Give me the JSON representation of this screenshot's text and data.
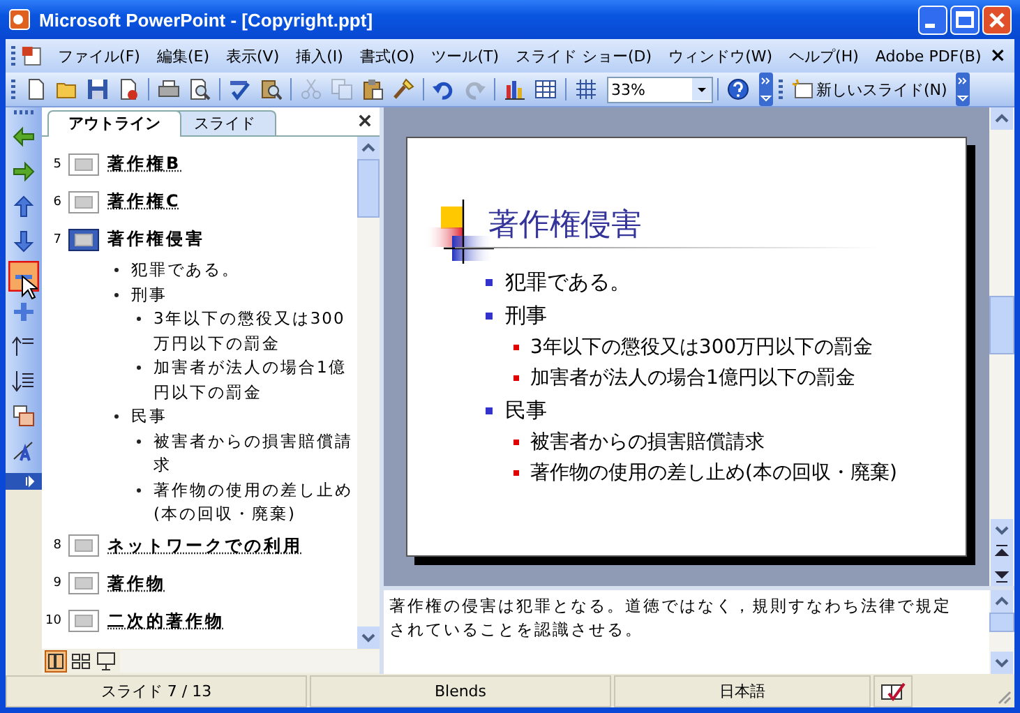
{
  "window": {
    "title": "Microsoft PowerPoint - [Copyright.ppt]"
  },
  "menu": {
    "items": [
      "ファイル(F)",
      "編集(E)",
      "表示(V)",
      "挿入(I)",
      "書式(O)",
      "ツール(T)",
      "スライド ショー(D)",
      "ウィンドウ(W)",
      "ヘルプ(H)",
      "Adobe PDF(B)"
    ],
    "close_glyph": "×"
  },
  "toolbar": {
    "groups": [
      [
        {
          "kind": "new",
          "disabled": false
        },
        {
          "kind": "open",
          "disabled": false
        },
        {
          "kind": "save",
          "disabled": false
        },
        {
          "kind": "permission",
          "disabled": false
        }
      ],
      [
        {
          "kind": "print",
          "disabled": false
        },
        {
          "kind": "preview",
          "disabled": false
        }
      ],
      [
        {
          "kind": "spell",
          "disabled": false
        },
        {
          "kind": "research",
          "disabled": false
        }
      ],
      [
        {
          "kind": "cut",
          "disabled": true
        },
        {
          "kind": "copy",
          "disabled": true
        },
        {
          "kind": "paste",
          "disabled": false
        },
        {
          "kind": "painter",
          "disabled": false
        }
      ],
      [
        {
          "kind": "undo",
          "disabled": false
        },
        {
          "kind": "redo",
          "disabled": true
        }
      ],
      [
        {
          "kind": "chart",
          "disabled": false
        },
        {
          "kind": "table",
          "disabled": false
        }
      ],
      [
        {
          "kind": "grid",
          "disabled": false
        }
      ]
    ],
    "zoom": "33%",
    "new_slide_button": "新しいスライド(N)"
  },
  "outline_tools": [
    {
      "kind": "promote",
      "selected": false
    },
    {
      "kind": "demote",
      "selected": false
    },
    {
      "kind": "up",
      "selected": false
    },
    {
      "kind": "down",
      "selected": false
    },
    {
      "kind": "collapse",
      "selected": true
    },
    {
      "kind": "expand",
      "selected": false
    },
    {
      "kind": "collapse_all",
      "selected": false
    },
    {
      "kind": "expand_all",
      "selected": false
    },
    {
      "kind": "summary",
      "selected": false
    },
    {
      "kind": "formatting",
      "selected": false
    }
  ],
  "tabs": [
    {
      "label": "アウトライン",
      "selected": true
    },
    {
      "label": "スライド",
      "selected": false
    }
  ],
  "outline": [
    {
      "number": "5",
      "title": "著作権B",
      "selected": false
    },
    {
      "number": "6",
      "title": "著作権C",
      "selected": false
    },
    {
      "number": "7",
      "title": "著作権侵害",
      "selected": true,
      "bullets": [
        {
          "text": "犯罪である。"
        },
        {
          "text": "刑事",
          "children": [
            {
              "text": "3年以下の懲役又は300万円以下の罰金"
            },
            {
              "text": "加害者が法人の場合1億円以下の罰金"
            }
          ]
        },
        {
          "text": "民事",
          "children": [
            {
              "text": "被害者からの損害賠償請求"
            },
            {
              "text": "著作物の使用の差し止め(本の回収・廃棄)"
            }
          ]
        }
      ]
    },
    {
      "number": "8",
      "title": "ネットワークでの利用",
      "selected": false
    },
    {
      "number": "9",
      "title": "著作物",
      "selected": false
    },
    {
      "number": "10",
      "title": "二次的著作物",
      "selected": false
    }
  ],
  "slide": {
    "title": "著作権侵害",
    "bullets": [
      {
        "text": "犯罪である。"
      },
      {
        "text": "刑事",
        "children": [
          {
            "text": "3年以下の懲役又は300万円以下の罰金"
          },
          {
            "text": "加害者が法人の場合1億円以下の罰金"
          }
        ]
      },
      {
        "text": "民事",
        "children": [
          {
            "text": "被害者からの損害賠償請求"
          },
          {
            "text": "著作物の使用の差し止め(本の回収・廃棄)"
          }
        ]
      }
    ]
  },
  "notes": {
    "text": "著作権の侵害は犯罪となる。道徳ではなく，規則すなわち法律で規定されていることを認識させる。"
  },
  "status_bar": {
    "slide": "スライド 7 / 13",
    "design": "Blends",
    "language": "日本語"
  }
}
